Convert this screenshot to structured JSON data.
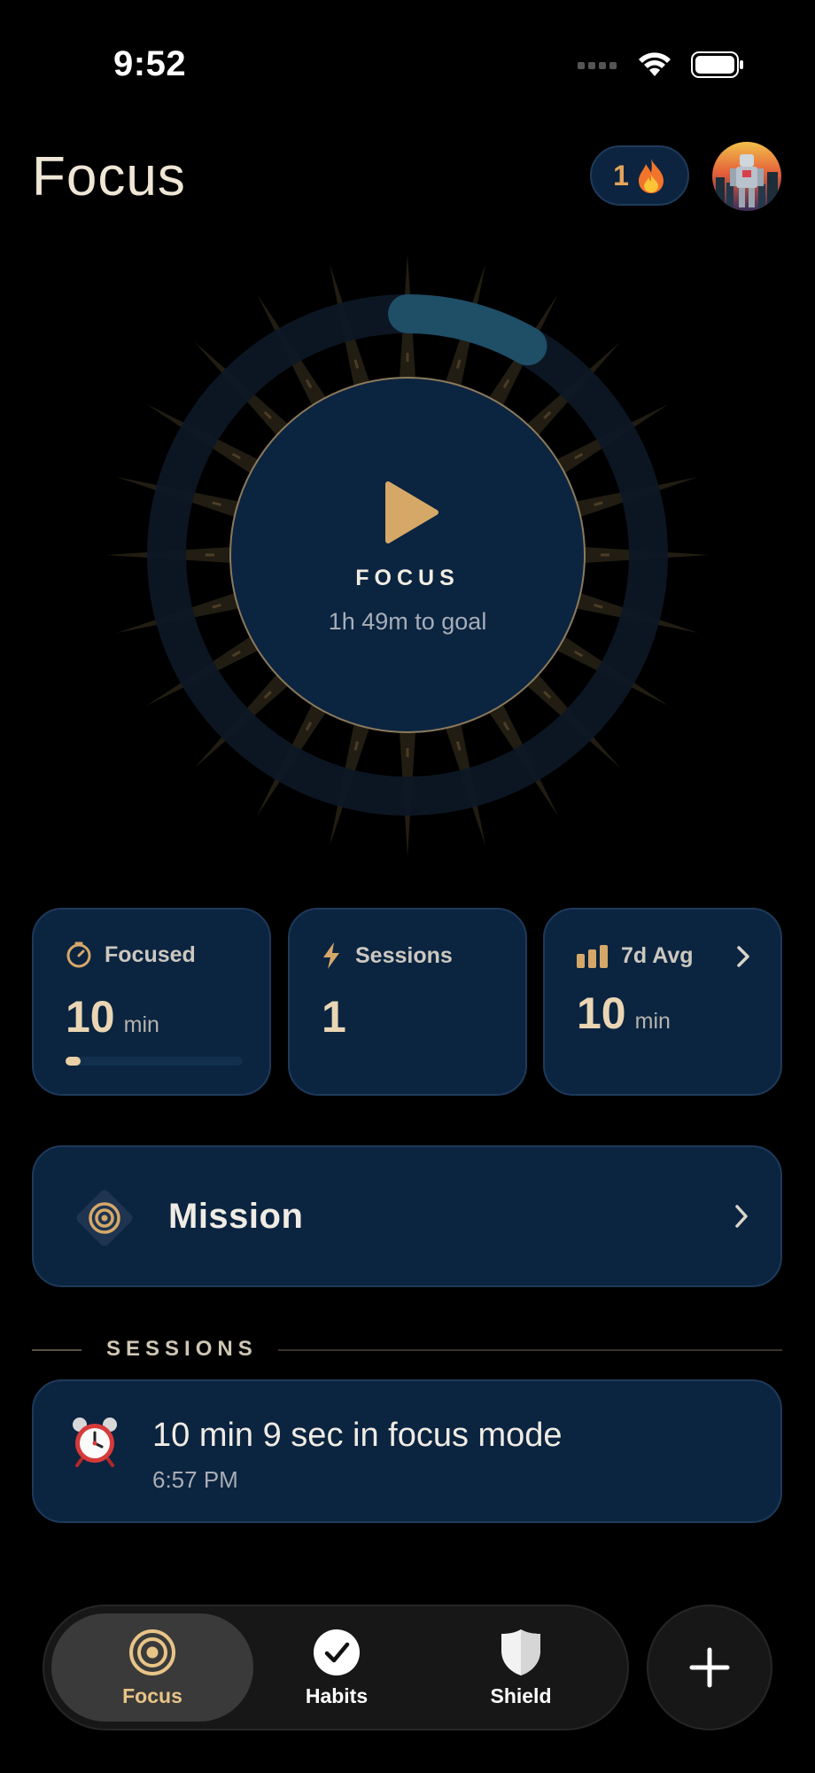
{
  "status_bar": {
    "time": "9:52"
  },
  "header": {
    "title": "Focus",
    "streak_count": "1"
  },
  "focus_dial": {
    "label": "FOCUS",
    "goal_text": "1h 49m to goal",
    "ring_progress": 0.083
  },
  "stats": {
    "focused": {
      "label": "Focused",
      "value": "10",
      "unit": "min",
      "progress": 0.083
    },
    "sessions": {
      "label": "Sessions",
      "value": "1"
    },
    "avg": {
      "label": "7d Avg",
      "value": "10",
      "unit": "min"
    }
  },
  "mission": {
    "label": "Mission"
  },
  "sessions_section": {
    "title": "SESSIONS",
    "items": [
      {
        "title": "10 min 9 sec in focus mode",
        "time": "6:57 PM"
      }
    ]
  },
  "tab_bar": {
    "tabs": [
      {
        "label": "Focus"
      },
      {
        "label": "Habits"
      },
      {
        "label": "Shield"
      }
    ]
  },
  "colors": {
    "accent": "#d6a868",
    "card_bg": "#0b2440",
    "ring_progress": "#1f4e67"
  },
  "icons": [
    "signal-icon",
    "wifi-icon",
    "battery-icon",
    "fire-icon",
    "play-icon",
    "timer-icon",
    "bolt-icon",
    "bar-chart-icon",
    "chevron-right-icon",
    "target-icon",
    "alarm-clock-icon",
    "check-circle-icon",
    "shield-icon",
    "plus-icon"
  ]
}
